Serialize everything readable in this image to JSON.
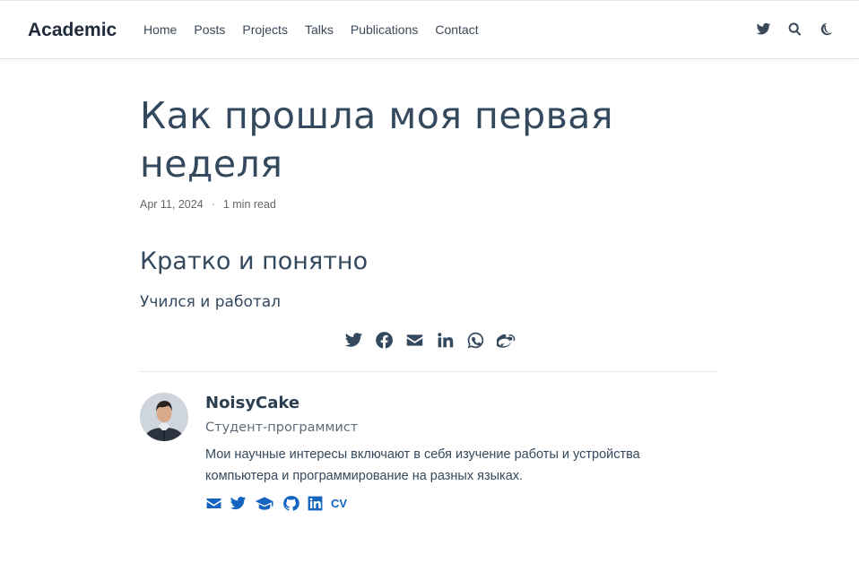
{
  "navbar": {
    "brand": "Academic",
    "links": [
      {
        "label": "Home"
      },
      {
        "label": "Posts"
      },
      {
        "label": "Projects"
      },
      {
        "label": "Talks"
      },
      {
        "label": "Publications"
      },
      {
        "label": "Contact"
      }
    ],
    "right_icons": [
      "twitter-icon",
      "search-icon",
      "moon-icon"
    ]
  },
  "article": {
    "title": "Как прошла моя первая неделя",
    "date": "Apr 11, 2024",
    "separator": "·",
    "reading_time": "1 min read",
    "heading": "Кратко и понятно",
    "body": "Учился и работал"
  },
  "share_icons": [
    "twitter-icon",
    "facebook-icon",
    "envelope-icon",
    "linkedin-icon",
    "whatsapp-icon",
    "weibo-icon"
  ],
  "author": {
    "name": "NoisyCake",
    "role": "Студент-программист",
    "bio": "Мои научные интересы включают в себя изучение работы и устройства компьютера и программирование на разных языках.",
    "links": [
      "envelope-icon",
      "twitter-icon",
      "graduation-cap-icon",
      "github-icon",
      "linkedin-icon"
    ],
    "cv_label": "CV"
  },
  "colors": {
    "text": "#34495e",
    "link_accent": "#1565c0",
    "divider": "#e8e8e8"
  }
}
